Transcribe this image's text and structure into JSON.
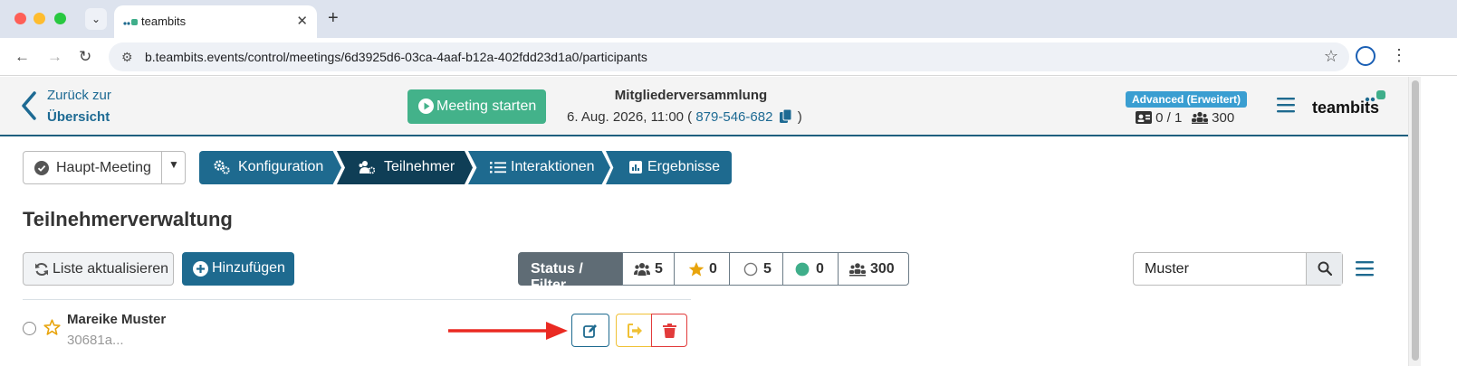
{
  "browser": {
    "tab_title": "teambits",
    "url": "b.teambits.events/control/meetings/6d3925d6-03ca-4aaf-b12a-402fdd23d1a0/participants"
  },
  "header": {
    "back_line1": "Zurück zur",
    "back_line2": "Übersicht",
    "start_button": "Meeting starten",
    "meeting_title": "Mitgliederversammlung",
    "meeting_date_prefix": "6. Aug. 2026, 11:00 (",
    "meeting_id": "879-546-682",
    "meeting_date_suffix": ")",
    "plan_badge": "Advanced (Erweitert)",
    "license_hosts": "0 / 1",
    "license_participants": "300",
    "logo": "teambits"
  },
  "toolbar": {
    "meeting_select": "Haupt-Meeting",
    "steps": [
      {
        "label": "Konfiguration",
        "icon": "gears-icon"
      },
      {
        "label": "Teilnehmer",
        "icon": "users-gear-icon"
      },
      {
        "label": "Interaktionen",
        "icon": "list-icon"
      },
      {
        "label": "Ergebnisse",
        "icon": "chart-icon"
      }
    ]
  },
  "page": {
    "title": "Teilnehmerverwaltung",
    "reload_button": "Liste aktualisieren",
    "add_button": "Hinzufügen",
    "filter_label": "Status / Filter",
    "filters": {
      "participants": "5",
      "favorites": "0",
      "offline": "5",
      "online": "0",
      "capacity": "300"
    },
    "search_value": "Muster"
  },
  "participants": [
    {
      "name": "Mareike Muster",
      "id": "30681a..."
    }
  ],
  "colors": {
    "primary": "#1e6a8f",
    "active_step": "#0f3e56",
    "start_green": "#43b28a",
    "favorite_gold": "#e8a40c",
    "leave_yellow": "#f0c136",
    "delete_red": "#e23b3b",
    "online_green": "#3fae8a",
    "annotation_arrow": "#ea2a22"
  }
}
